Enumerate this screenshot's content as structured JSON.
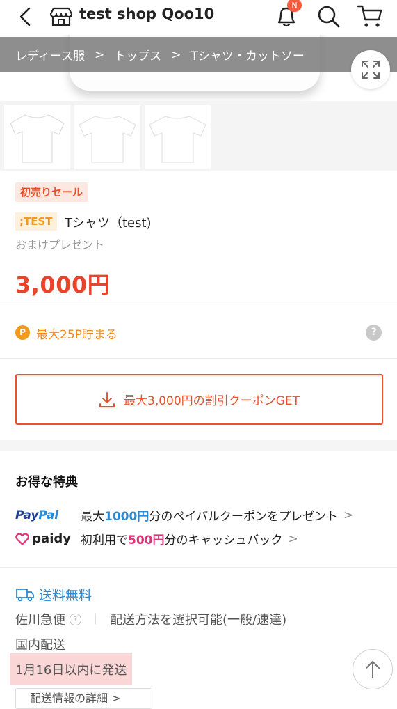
{
  "header": {
    "shop_name": "test shop Qoo10",
    "notification_badge": "N"
  },
  "breadcrumb": {
    "items": [
      "レディース服",
      "トップス",
      "Tシャツ・カットソー"
    ],
    "separator": ">"
  },
  "product": {
    "sale_tag": "初売りセール",
    "brand_tag": ";TEST",
    "name": "Tシャツ（test)",
    "gift_note": "おまけプレゼント",
    "price": "3,000円",
    "points_icon": "P",
    "points_text": "最大25P貯まる",
    "help_icon": "?"
  },
  "coupon": {
    "label": "最大3,000円の割引クーポンGET"
  },
  "benefits": {
    "title": "お得な特典",
    "paypal": {
      "logo_part1": "Pay",
      "logo_part2": "Pal",
      "prefix": "最大",
      "amount": "1000円",
      "suffix": "分のペイパルクーポンをプレゼント",
      "chevron": ">"
    },
    "paidy": {
      "logo": "paidy",
      "prefix": "初利用で",
      "amount": "500円",
      "suffix": "分のキャッシュバック",
      "chevron": ">"
    }
  },
  "shipping": {
    "free_label": "送料無料",
    "carrier": "佐川急便",
    "carrier_help": "?",
    "method_note": "配送方法を選択可能(一般/速達)",
    "domestic": "国内配送",
    "ship_date": "1月16日以内に発送",
    "details_button": "配送情報の詳細 >"
  },
  "colors": {
    "accent_red": "#e8512c",
    "price_red": "#e8442a",
    "points_orange": "#f08a1a",
    "link_blue": "#2b8ad6",
    "paidy_pink": "#e0337a"
  },
  "icons": [
    "back-icon",
    "shop-icon",
    "bell-icon",
    "search-icon",
    "cart-icon",
    "expand-icon",
    "download-icon",
    "truck-icon",
    "arrow-up-icon"
  ]
}
